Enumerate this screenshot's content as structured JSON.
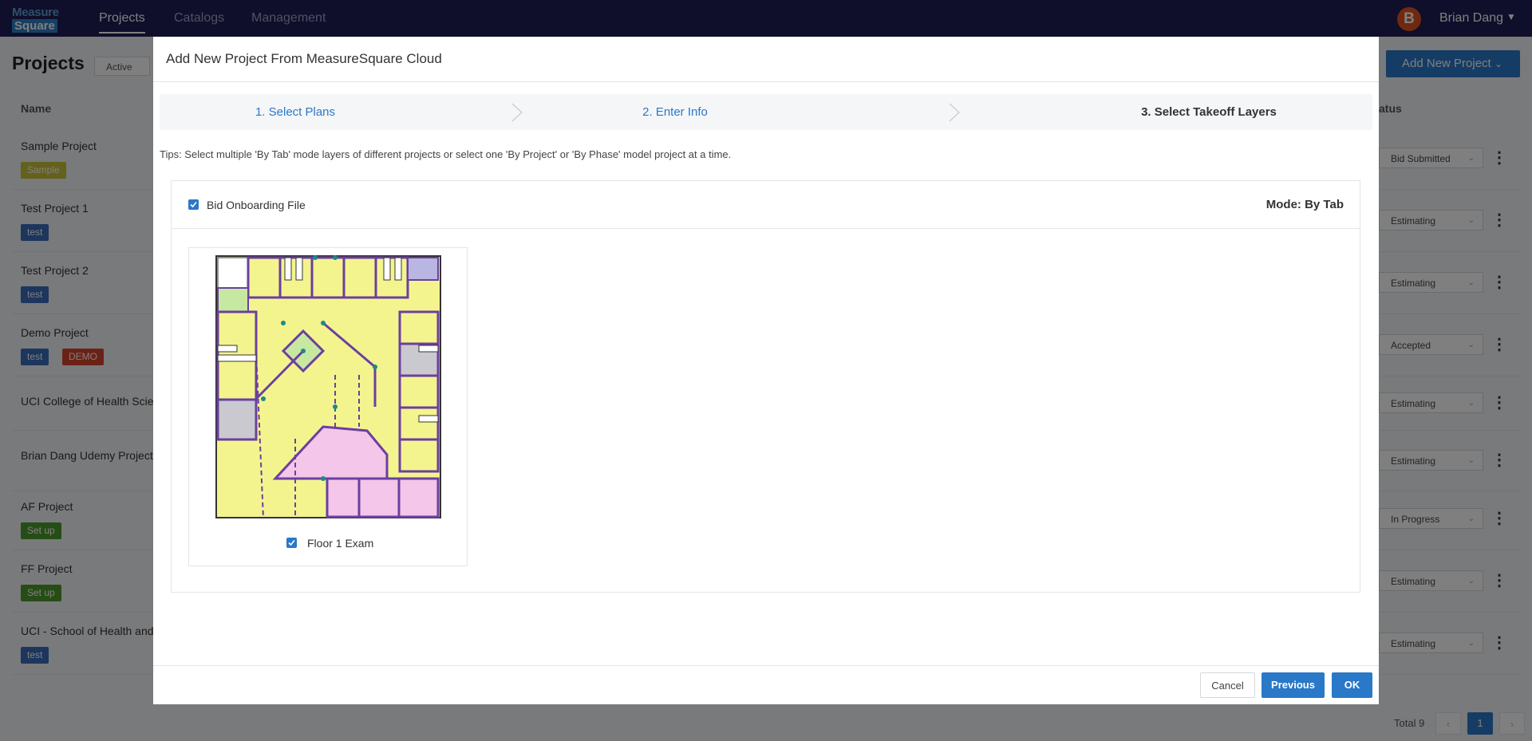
{
  "app": {
    "logo_line1": "Measure",
    "logo_line2": "Square",
    "nav": [
      "Projects",
      "Catalogs",
      "Management"
    ],
    "user": {
      "initial": "B",
      "name": "Brian Dang"
    }
  },
  "background": {
    "page_title": "Projects",
    "filter": "Active",
    "add_button": "Add New Project",
    "columns": {
      "name": "Name",
      "status": "atus"
    },
    "rows": [
      {
        "name": "Sample Project",
        "tags": [
          {
            "label": "Sample",
            "color": "#c9c23a"
          }
        ],
        "status": "Bid Submitted"
      },
      {
        "name": "Test Project 1",
        "tags": [
          {
            "label": "test",
            "color": "#3a6dbb"
          }
        ],
        "status": "Estimating"
      },
      {
        "name": "Test Project 2",
        "tags": [
          {
            "label": "test",
            "color": "#3a6dbb"
          }
        ],
        "status": "Estimating"
      },
      {
        "name": "Demo Project",
        "tags": [
          {
            "label": "test",
            "color": "#3a6dbb"
          },
          {
            "label": "DEMO",
            "color": "#d6442d"
          }
        ],
        "status": "Accepted"
      },
      {
        "name": "UCI College of Health Scien",
        "tags": [],
        "status": "Estimating"
      },
      {
        "name": "Brian Dang Udemy Project",
        "tags": [],
        "status": "Estimating"
      },
      {
        "name": "AF Project",
        "tags": [
          {
            "label": "Set up",
            "color": "#4e9a2d"
          }
        ],
        "status": "In Progress"
      },
      {
        "name": "FF Project",
        "tags": [
          {
            "label": "Set up",
            "color": "#4e9a2d"
          }
        ],
        "status": "Estimating"
      },
      {
        "name": "UCI - School of Health and I",
        "tags": [
          {
            "label": "test",
            "color": "#3a6dbb"
          }
        ],
        "status": "Estimating"
      }
    ],
    "total": "Total 9",
    "page": "1"
  },
  "modal": {
    "title": "Add New Project From MeasureSquare Cloud",
    "steps": [
      "1. Select Plans",
      "2. Enter Info",
      "3. Select Takeoff Layers"
    ],
    "tips": "Tips: Select multiple 'By Tab' mode layers of different projects or select one 'By Project' or 'By Phase' model project at a time.",
    "file_name": "Bid Onboarding File",
    "file_checked": true,
    "mode": "Mode: By Tab",
    "layer_name": "Floor 1 Exam",
    "layer_checked": true,
    "buttons": {
      "cancel": "Cancel",
      "previous": "Previous",
      "ok": "OK"
    }
  },
  "colors": {
    "accent": "#2a78c8",
    "nav_bg": "#1e1d56",
    "plan_fill": "#f4f48e",
    "plan_pink": "#f3c6ea",
    "plan_outline": "#6b3fa0"
  }
}
